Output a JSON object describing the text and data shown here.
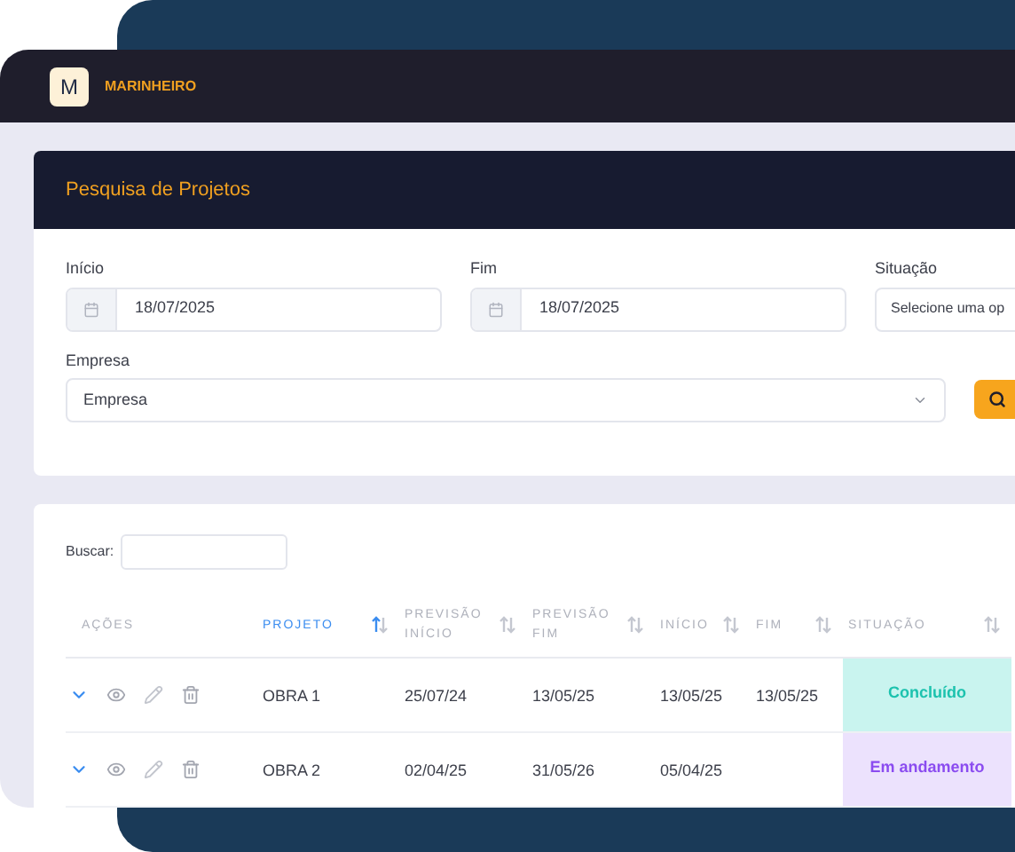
{
  "app": {
    "logo_letter": "M",
    "name": "MARINHEIRO"
  },
  "search_panel": {
    "title": "Pesquisa de Projetos",
    "fields": [
      {
        "label": "Início",
        "value": "18/07/2025",
        "kind": "date"
      },
      {
        "label": "Fim",
        "value": "18/07/2025",
        "kind": "date"
      },
      {
        "label": "Situação",
        "value": "Selecione uma op",
        "kind": "select"
      }
    ],
    "company": {
      "label": "Empresa",
      "value": "Empresa"
    }
  },
  "table": {
    "search_label": "Buscar:",
    "columns": [
      {
        "label": "AÇÕES",
        "sortable": false,
        "sorted": false
      },
      {
        "label": "PROJETO",
        "sortable": true,
        "sorted": true
      },
      {
        "label": "PREVISÃO INÍCIO",
        "sortable": true,
        "sorted": false
      },
      {
        "label": "PREVISÃO FIM",
        "sortable": true,
        "sorted": false
      },
      {
        "label": "INÍCIO",
        "sortable": true,
        "sorted": false
      },
      {
        "label": "FIM",
        "sortable": true,
        "sorted": false
      },
      {
        "label": "SITUAÇÃO",
        "sortable": true,
        "sorted": false
      }
    ],
    "rows": [
      {
        "project": "OBRA 1",
        "planned_start": "25/07/24",
        "planned_end": "13/05/25",
        "start": "13/05/25",
        "end": "13/05/25",
        "status": "Concluído",
        "kind": "done"
      },
      {
        "project": "OBRA 2",
        "planned_start": "02/04/25",
        "planned_end": "31/05/26",
        "start": "05/04/25",
        "status": "Em andamento",
        "kind": "progress"
      }
    ]
  }
}
